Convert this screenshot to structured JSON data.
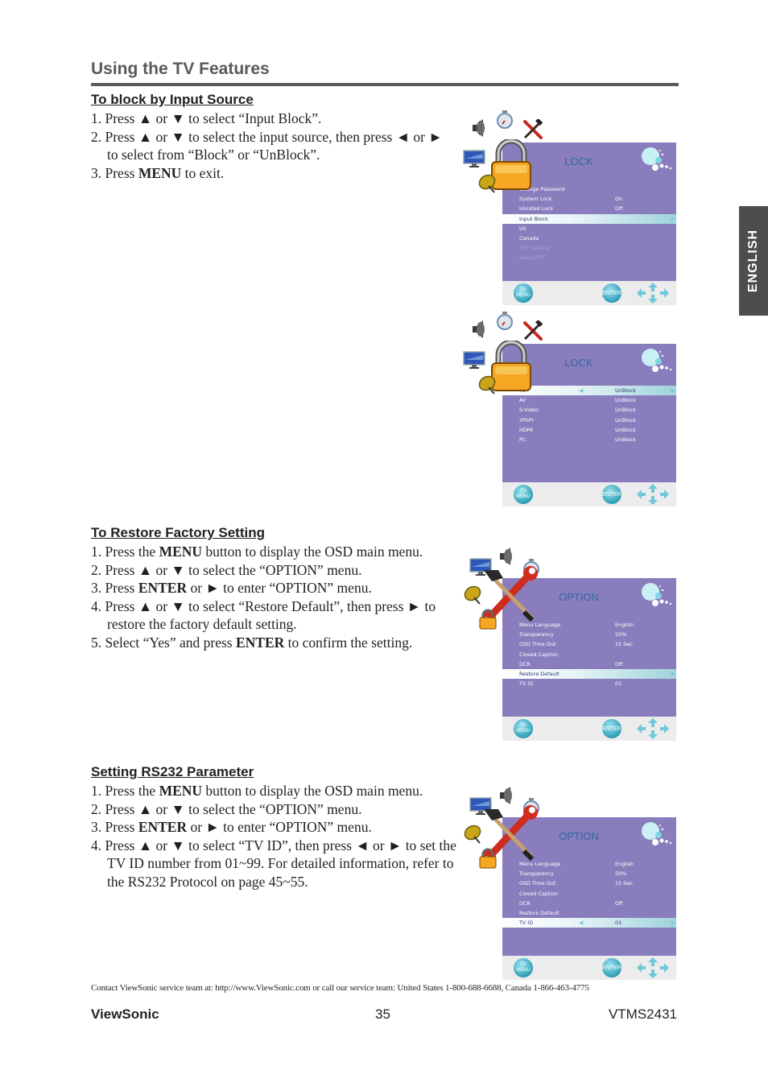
{
  "header": {
    "title": "Using the TV Features"
  },
  "side_tab": {
    "label": "ENGLISH"
  },
  "sections": [
    {
      "heading": "To block by Input Source",
      "steps": [
        [
          "1. Press ▲ or ▼ to select “Input Block”."
        ],
        [
          "2. Press ▲ or ▼ to select the input source, then press ◄ or ► to select from “Block” or “UnBlock”."
        ],
        [
          "3. Press ",
          "MENU",
          " to exit."
        ]
      ]
    },
    {
      "heading": "To Restore Factory Setting",
      "steps": [
        [
          "1. Press the ",
          "MENU",
          " button to display the OSD main menu."
        ],
        [
          "2. Press ▲ or ▼ to select the “OPTION” menu."
        ],
        [
          "3. Press ",
          "ENTER",
          " or ► to enter “OPTION” menu."
        ],
        [
          "4. Press ▲ or ▼ to select “Restore Default”, then press ► to restore the factory default setting."
        ],
        [
          "5. Select “Yes” and press ",
          "ENTER",
          " to confirm the setting."
        ]
      ]
    },
    {
      "heading": "Setting RS232 Parameter",
      "steps": [
        [
          "1. Press the ",
          "MENU",
          " button to display the OSD main menu."
        ],
        [
          "2. Press ▲ or ▼ to select the “OPTION” menu."
        ],
        [
          "3. Press ",
          "ENTER",
          " or ► to enter “OPTION” menu."
        ],
        [
          "4. Press ▲ or ▼ to select “TV ID”, then press ◄ or ► to set the TV ID number from 01~99. For detailed information, refer to the RS232 Protocol on page 45~55."
        ]
      ]
    }
  ],
  "osd_screens": [
    {
      "title": "LOCK",
      "feature_icon": "lock",
      "rows": [
        {
          "label": "Change Password",
          "value": "",
          "state": "normal"
        },
        {
          "label": "System Lock",
          "value": "On",
          "state": "normal"
        },
        {
          "label": "Unrated Lock",
          "value": "Off",
          "state": "normal"
        },
        {
          "label": "Input Block",
          "value": "",
          "state": "selected"
        },
        {
          "label": "US",
          "value": "",
          "state": "normal"
        },
        {
          "label": "Canada",
          "value": "",
          "state": "normal"
        },
        {
          "label": "RRT Setting",
          "value": "",
          "state": "disabled"
        },
        {
          "label": "Reset RRT",
          "value": "",
          "state": "disabled"
        }
      ]
    },
    {
      "title": "LOCK",
      "feature_icon": "lock",
      "rows": [
        {
          "label": "TV",
          "value": "UnBlock",
          "state": "selected-adjust"
        },
        {
          "label": "AV",
          "value": "UnBlock",
          "state": "normal"
        },
        {
          "label": "S-Video",
          "value": "UnBlock",
          "state": "normal"
        },
        {
          "label": "YPbPr",
          "value": "UnBlock",
          "state": "normal"
        },
        {
          "label": "HDMI",
          "value": "UnBlock",
          "state": "normal"
        },
        {
          "label": "PC",
          "value": "UnBlock",
          "state": "normal"
        }
      ]
    },
    {
      "title": "OPTION",
      "feature_icon": "tools",
      "rows": [
        {
          "label": "Menu Language",
          "value": "English",
          "state": "normal"
        },
        {
          "label": "Transparency",
          "value": "50%",
          "state": "normal"
        },
        {
          "label": "OSD Time Out",
          "value": "15 Sec.",
          "state": "normal"
        },
        {
          "label": "Closed Caption",
          "value": "",
          "state": "normal"
        },
        {
          "label": "DCR",
          "value": "Off",
          "state": "normal"
        },
        {
          "label": "Restore Default",
          "value": "",
          "state": "selected"
        },
        {
          "label": "TV ID",
          "value": "01",
          "state": "normal"
        }
      ]
    },
    {
      "title": "OPTION",
      "feature_icon": "tools",
      "rows": [
        {
          "label": "Menu Language",
          "value": "English",
          "state": "normal"
        },
        {
          "label": "Transparency",
          "value": "50%",
          "state": "normal"
        },
        {
          "label": "OSD Time Out",
          "value": "15 Sec.",
          "state": "normal"
        },
        {
          "label": "Closed Caption",
          "value": "",
          "state": "normal"
        },
        {
          "label": "DCR",
          "value": "Off",
          "state": "normal"
        },
        {
          "label": "Restore Default",
          "value": "",
          "state": "normal"
        },
        {
          "label": "TV ID",
          "value": "01",
          "state": "selected-adjust"
        }
      ]
    }
  ],
  "osd_footer": {
    "menu_button": "TV MENU",
    "enter_button": "ENTER"
  },
  "footer": {
    "contact": "Contact ViewSonic service team at: http://www.ViewSonic.com or call our service team: United States 1-800-688-6688, Canada 1-866-463-4775",
    "brand": "ViewSonic",
    "page_number": "35",
    "model": "VTMS2431"
  },
  "colors": {
    "osd_panel": "#8a7dbd",
    "osd_title": "#2a6aa0",
    "side_tab": "#4d4d4f",
    "title_gray": "#58595b"
  }
}
